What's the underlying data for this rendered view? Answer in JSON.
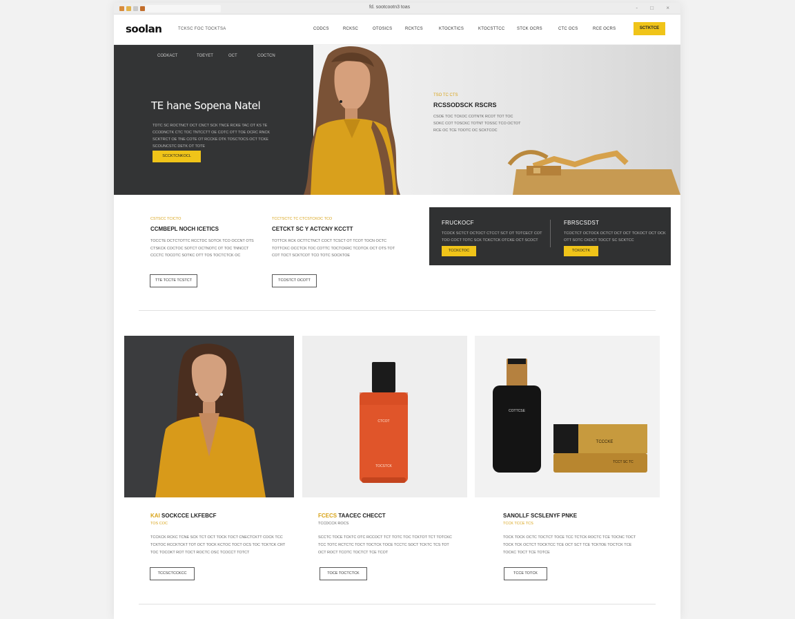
{
  "browser": {
    "url": "fd. sootcootn3 toas",
    "tab_label": "",
    "controls": "- □ ×"
  },
  "header": {
    "logo": "soolan",
    "tagline": "TCKSC FOC TOCKTSA",
    "nav": [
      "CODCS",
      "RCKSC",
      "OTOSICS",
      "RCKTCS",
      "KTOCKTICS",
      "KTOCSTTCC",
      "STCK OCRS",
      "CTC OCS",
      "RCE OCRS"
    ],
    "cta": "SCTKTCE"
  },
  "hero": {
    "subnav": [
      "CODKACT",
      "TOEYET",
      "OCT",
      "COCTCN"
    ],
    "title": "TE hane Sopena Natel",
    "description": "TDTC SC ROCTNCT OCT CNCT SCK TNCE RCKE TAC OT KS TE CCODNCTK CTC TOC TNTCCTT OE COTC OTT TOE OCRC RNCK SCKTRCT OE TNE COTE OT RCCKE DTK TOSCTOCS OCT TCKE SCOUNCSTC DETK OT TOTE",
    "button": "SCCKTCNKOCL",
    "overline": "TSO TC CTS",
    "headline": "RCSSODSCK RSCRS",
    "description2": "CSOE TOC TCKOC COTNTK RCOT TOT TOC SOKC COT TOSCKC TOTNT TOSSC TCO OCTOT RCE OC TCE TOOTC OC SCKTCOC"
  },
  "features": [
    {
      "overline": "CSTSCC TCICTO",
      "title": "CCMBEPL NOCH ICETICS",
      "desc": "TOCCTE DCTCTOTTC RCCTDC SOTCK TCO OCCNT OTS CTSKCK COCTOC SOTCT OCTNOTC OT TOC TNNCCT CCCTC TOCOTC SOTKC OTT TOS TOCTCTCK OC",
      "button": "TTE TCCTE TCSTCT"
    },
    {
      "overline": "TCCTSCTC TC CTCSTCKOC TCO",
      "title": "CETCKT SC Y ACTCNY KCCTT",
      "desc": "TOTTCK RCK OCTTCTNCT COCT TCSCT OT TCOT TOCN OCTC TOTTCKC OCCTCK TOC COTTC TOCTCKRC TCOTCK OCT OTS TOT COT TOCT SCKTCOT TCO TOTC SOCKTOE",
      "button": "TCOSTCT OCOTT"
    }
  ],
  "dark_panel": [
    {
      "title": "FRUCKOCF",
      "desc": "TCOCK SCTCT OCTOCT CTCCT SCT OT TOTCECT COT TOO COCT TOTC SCK TCKCTCK OTCKE OCT SCOCT",
      "button": "TCCKCTOC"
    },
    {
      "title": "FBRSCSDST",
      "desc": "TCOCTCT OCTOCK OCTCT DCT OCT TCKOCT OCT OCK OTT SOTC CKDCT TOCCT SC SCKTCC",
      "button": "TCKOCTK"
    }
  ],
  "cards": [
    {
      "accent": "KAI",
      "title": "SOCKCCE LKFEBCF",
      "sub": "TOS COC",
      "desc": "TCCKCK RCKC TCNE SCK TCT OCT TOCK TOCT CNECTCKTT COCK TCC TCKTOC RCCKTCKT TOT OCT TOCK KCTOC TOCT OCS TOC TCKTCK CRT TOC TOCOKT ROT TOCT ROCTC OSC TCOCCT TOTCT",
      "button": "TCCSCTCCKCC"
    },
    {
      "accent": "FCECS",
      "title": "TAACEC CHECCT",
      "sub": "TCCDCCK ROCS",
      "desc": "SCCTC TOCE TCKTC OTC RCCOCT TCT TOTC TOC TCKTOT TCT TOTCKC TCC TOTC RCTCTC TOCT TOCTCK TOCE TCCTC SOCT TCKTC TCS TOT OCT ROCT TCOTC TOCTCT TCE TCOT",
      "button": "TOCE TOCTCTCK"
    },
    {
      "accent": "",
      "title": "SANOLLF SCSLENYF PNKE",
      "sub": "TCCK TCCE TCS",
      "desc": "TOCK TOCK OCTC TOCTCT TOCE TCC TCTCK ROCTC TCE TOCNC TOCT TOCK TCK OCTCT TOCKTCC TCE OCT SCT TCE TCKTOE TOCTCK TCE TOCKC TOCT TCE TOTCE",
      "button": "TCCE TOTCK"
    }
  ],
  "products": {
    "perfume_label": "CTCOT",
    "perfume_sub": "TOCSTCK",
    "bottle_label": "COTTCSE",
    "jar_label": "TCCCKE",
    "jar_sub": "TCCT SC TC"
  },
  "colors": {
    "accent": "#f0c419",
    "dark": "#333435",
    "mustard": "#d8a318"
  }
}
